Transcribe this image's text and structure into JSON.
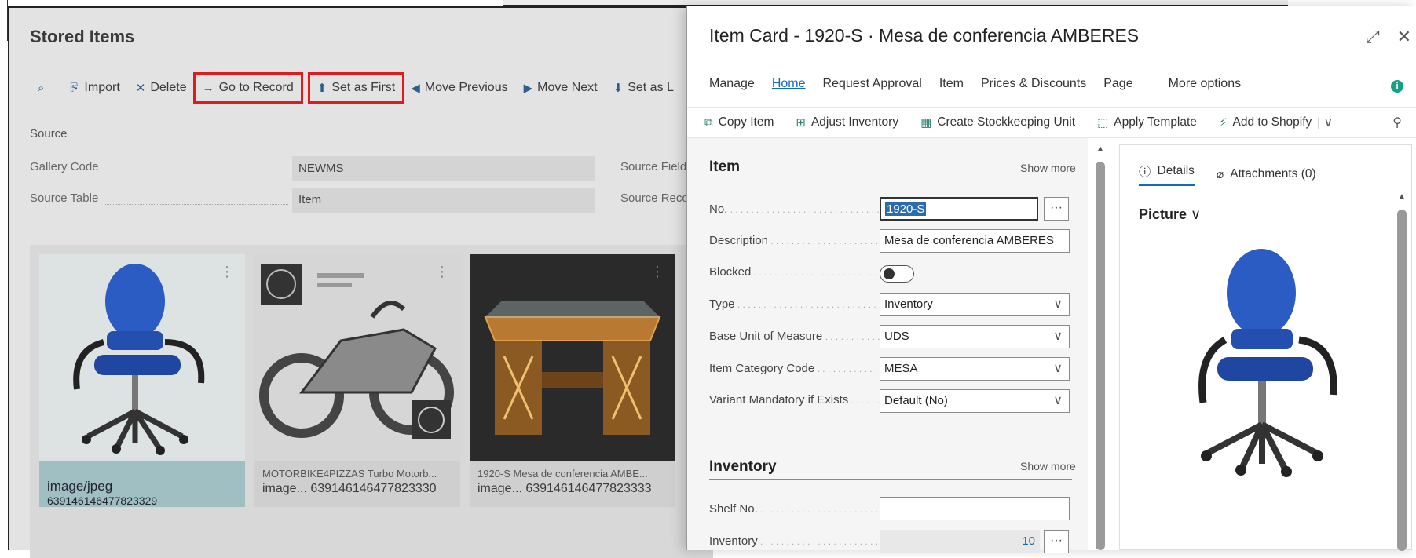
{
  "stored": {
    "title": "Stored Items",
    "toolbar": {
      "import": "Import",
      "delete": "Delete",
      "go_to_record": "Go to Record",
      "set_as_first": "Set as First",
      "move_previous": "Move Previous",
      "move_next": "Move Next",
      "set_as_last": "Set as L"
    },
    "source_header": "Source",
    "fields": {
      "gallery_code_label": "Gallery Code",
      "gallery_code_value": "NEWMS",
      "source_table_label": "Source Table",
      "source_table_value": "Item",
      "source_field_label": "Source Field",
      "source_record_label": "Source Reco"
    },
    "tiles": [
      {
        "caption1": "image/jpeg",
        "caption2": "639146146477823329"
      },
      {
        "caption1": "MOTORBIKE4PIZZAS Turbo Motorb...",
        "caption2": "image...  639146146477823330"
      },
      {
        "caption1": "1920-S Mesa de conferencia AMBE...",
        "caption2": "image...  639146146477823333"
      }
    ]
  },
  "card": {
    "title": "Item Card - 1920-S · Mesa de conferencia AMBERES",
    "menu": {
      "manage": "Manage",
      "home": "Home",
      "request_approval": "Request Approval",
      "item": "Item",
      "prices_discounts": "Prices & Discounts",
      "page": "Page",
      "more_options": "More options"
    },
    "actions": {
      "copy_item": "Copy Item",
      "adjust_inventory": "Adjust Inventory",
      "create_sku": "Create Stockkeeping Unit",
      "apply_template": "Apply Template",
      "add_to_shopify": "Add to Shopify"
    },
    "item_group": {
      "title": "Item",
      "show_more": "Show more",
      "no_label": "No.",
      "no_value": "1920-S",
      "description_label": "Description",
      "description_value": "Mesa de conferencia AMBERES",
      "blocked_label": "Blocked",
      "type_label": "Type",
      "type_value": "Inventory",
      "base_uom_label": "Base Unit of Measure",
      "base_uom_value": "UDS",
      "category_label": "Item Category Code",
      "category_value": "MESA",
      "variant_label": "Variant Mandatory if Exists",
      "variant_value": "Default (No)"
    },
    "inventory_group": {
      "title": "Inventory",
      "show_more": "Show more",
      "shelf_label": "Shelf No.",
      "shelf_value": "",
      "inventory_label": "Inventory",
      "inventory_value": "10"
    },
    "factbox": {
      "details_tab": "Details",
      "attachments_tab": "Attachments (0)",
      "picture_label": "Picture"
    }
  },
  "colors": {
    "accent": "#0f6cbd",
    "highlight": "#e11b1b",
    "selected_tile": "#9fbfc2"
  }
}
